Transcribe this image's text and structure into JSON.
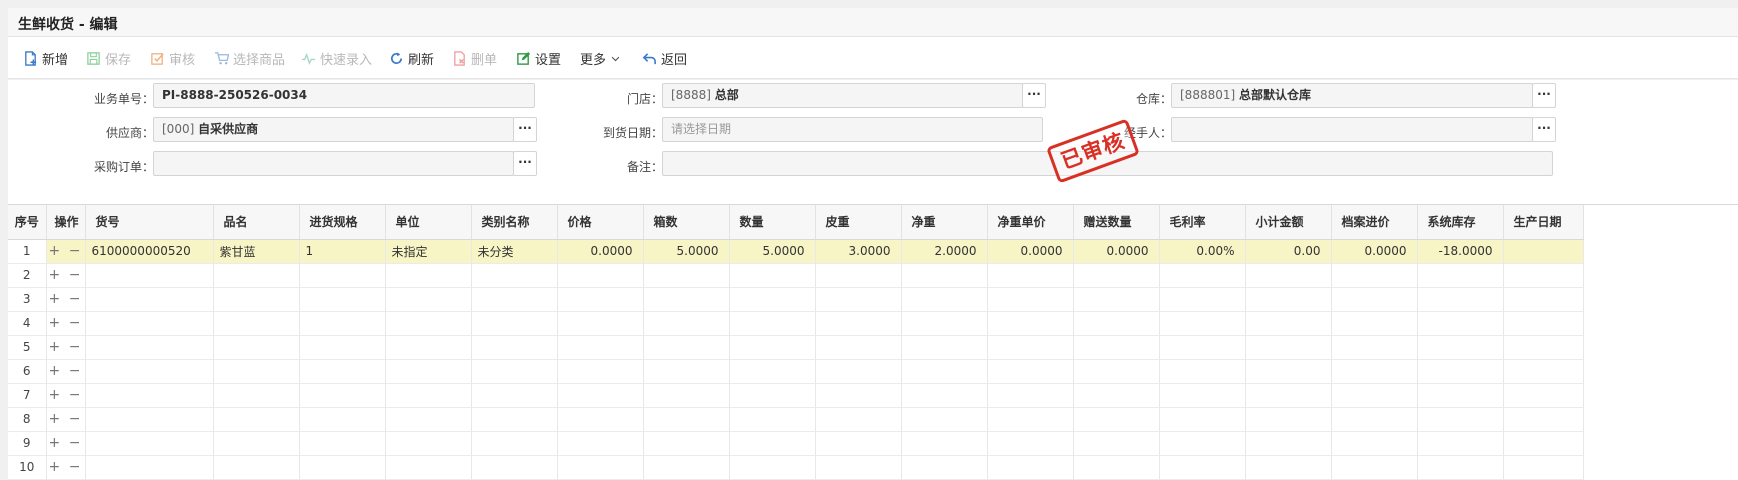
{
  "title": "生鲜收货 - 编辑",
  "toolbar": {
    "buttons": [
      {
        "label": "新增",
        "enabled": true
      },
      {
        "label": "保存",
        "enabled": false
      },
      {
        "label": "审核",
        "enabled": false
      },
      {
        "label": "选择商品",
        "enabled": false
      },
      {
        "label": "快速录入",
        "enabled": false
      },
      {
        "label": "刷新",
        "enabled": true
      },
      {
        "label": "删单",
        "enabled": false
      },
      {
        "label": "设置",
        "enabled": true
      },
      {
        "label": "更多",
        "enabled": true
      },
      {
        "label": "返回",
        "enabled": true
      }
    ]
  },
  "form": {
    "doc_no": {
      "label": "业务单号：",
      "value": "PI-8888-250526-0034"
    },
    "store": {
      "label": "门店：",
      "code": "[8888]",
      "name": "总部"
    },
    "warehouse": {
      "label": "仓库：",
      "code": "[888801]",
      "name": "总部默认仓库"
    },
    "supplier": {
      "label": "供应商：",
      "code": "[000]",
      "name": "自采供应商"
    },
    "arrival_date": {
      "label": "到货日期：",
      "placeholder": "请选择日期"
    },
    "handler": {
      "label": "经手人：",
      "value": ""
    },
    "purchase_order": {
      "label": "采购订单：",
      "value": ""
    },
    "remark": {
      "label": "备注：",
      "value": ""
    },
    "ellipsis": "···"
  },
  "stamp": "已审核",
  "table": {
    "columns": [
      "序号",
      "操作",
      "货号",
      "品名",
      "进货规格",
      "单位",
      "类别名称",
      "价格",
      "箱数",
      "数量",
      "皮重",
      "净重",
      "净重单价",
      "赠送数量",
      "毛利率",
      "小计金额",
      "档案进价",
      "系统库存",
      "生产日期"
    ],
    "op_symbols": "+ −",
    "rows": [
      {
        "no": "1",
        "cells": [
          "6100000000520",
          "紫甘蓝",
          "1",
          "未指定",
          "未分类",
          "0.0000",
          "5.0000",
          "5.0000",
          "3.0000",
          "2.0000",
          "0.0000",
          "0.0000",
          "0.00%",
          "0.00",
          "0.0000",
          "-18.0000",
          ""
        ]
      },
      {
        "no": "2",
        "cells": []
      },
      {
        "no": "3",
        "cells": []
      },
      {
        "no": "4",
        "cells": []
      },
      {
        "no": "5",
        "cells": []
      },
      {
        "no": "6",
        "cells": []
      },
      {
        "no": "7",
        "cells": []
      },
      {
        "no": "8",
        "cells": []
      },
      {
        "no": "9",
        "cells": []
      },
      {
        "no": "10",
        "cells": []
      }
    ]
  },
  "colors": {
    "selected_row": "#f7f4c5",
    "stamp": "#d93025",
    "icon_blue": "#3a78c9",
    "icon_green": "#2e9a46",
    "icon_red": "#e5534b",
    "icon_orange": "#f0a050"
  }
}
